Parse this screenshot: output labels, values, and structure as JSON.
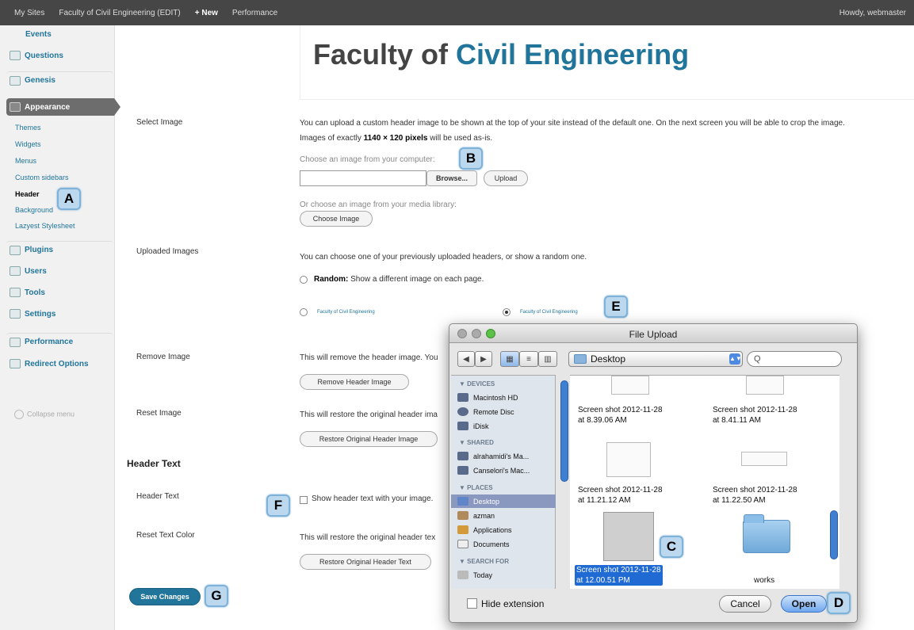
{
  "adminbar": {
    "items": [
      "My Sites",
      "Faculty of Civil Engineering (EDIT)",
      "+ New",
      "Performance"
    ],
    "howdy": "Howdy, webmaster"
  },
  "sidebar": {
    "menus": {
      "events": "Events",
      "questions": "Questions",
      "genesis": "Genesis",
      "appearance": "Appearance",
      "plugins": "Plugins",
      "users": "Users",
      "tools": "Tools",
      "settings": "Settings",
      "performance": "Performance",
      "redirect": "Redirect Options"
    },
    "submenu": [
      "Themes",
      "Widgets",
      "Menus",
      "Custom sidebars",
      "Header",
      "Background",
      "Lazyest Stylesheet"
    ],
    "collapse": "Collapse menu"
  },
  "site_title": {
    "part1": "Faculty of ",
    "part2": "Civil Engineering"
  },
  "select_image": {
    "label": "Select Image",
    "desc_line1": "You can upload a custom header image to be shown at the top of your site instead of the default one. On the next screen you will be able to crop the image.",
    "desc_line2_pre": "Images of exactly ",
    "desc_line2_bold": "1140 × 120 pixels",
    "desc_line2_post": " will be used as-is.",
    "choose_computer": "Choose an image from your computer:",
    "browse": "Browse...",
    "upload": "Upload",
    "choose_library": "Or choose an image from your media library:",
    "choose_image": "Choose Image"
  },
  "uploaded_images": {
    "label": "Uploaded Images",
    "desc": "You can choose one of your previously uploaded headers, or show a random one.",
    "random_bold": "Random:",
    "random_text": " Show a different image on each page.",
    "thumb1": "Faculty of Civil Engineering",
    "thumb2": "Faculty of Civil Engineering"
  },
  "remove_image": {
    "label": "Remove Image",
    "desc": "This will remove the header image. You",
    "button": "Remove Header Image"
  },
  "reset_image": {
    "label": "Reset Image",
    "desc": "This will restore the original header ima",
    "button": "Restore Original Header Image"
  },
  "header_text": {
    "heading": "Header Text",
    "label": "Header Text",
    "checkbox_label": "Show header text with your image.",
    "reset_label": "Reset Text Color",
    "reset_desc": "This will restore the original header tex",
    "reset_button": "Restore Original Header Text"
  },
  "save_button": "Save Changes",
  "markers": {
    "a": "A",
    "b": "B",
    "c": "C",
    "d": "D",
    "e": "E",
    "f": "F",
    "g": "G"
  },
  "dialog": {
    "title": "File Upload",
    "location": "Desktop",
    "search_glyph": "Q",
    "sections": {
      "devices": "▼ DEVICES",
      "shared": "▼ SHARED",
      "places": "▼ PLACES",
      "search_for": "▼ SEARCH FOR"
    },
    "devices": [
      "Macintosh HD",
      "Remote Disc",
      "iDisk"
    ],
    "shared": [
      "alrahamidi's Ma...",
      "Canselori's Mac..."
    ],
    "places": [
      "Desktop",
      "azman",
      "Applications",
      "Documents"
    ],
    "search_for": [
      "Today"
    ],
    "files": {
      "f1": [
        "Screen shot 2012-11-28",
        "at 8.39.06 AM"
      ],
      "f2": [
        "Screen shot 2012-11-28",
        "at 8.41.11 AM"
      ],
      "f3": [
        "Screen shot 2012-11-28",
        "at 11.21.12 AM"
      ],
      "f4": [
        "Screen shot 2012-11-28",
        "at 11.22.50 AM"
      ],
      "f5": [
        "Screen shot 2012-11-28",
        "at 12.00.51 PM"
      ],
      "f6": "works"
    },
    "hide_extension": "Hide extension",
    "cancel": "Cancel",
    "open": "Open"
  }
}
